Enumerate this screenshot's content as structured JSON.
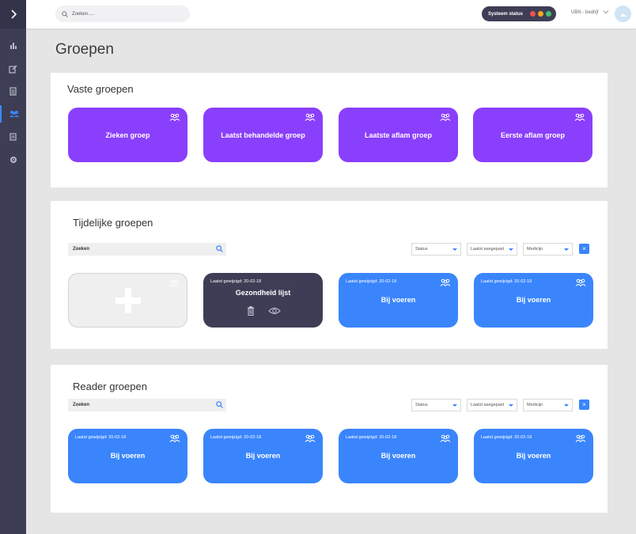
{
  "sidebar": {
    "toggle_icon": "chevron-right-icon",
    "items": [
      {
        "icon": "bar-chart-icon"
      },
      {
        "icon": "edit-icon"
      },
      {
        "icon": "document-icon"
      },
      {
        "icon": "users-icon",
        "active": true
      },
      {
        "icon": "list-icon"
      },
      {
        "icon": "gear-icon"
      }
    ]
  },
  "topbar": {
    "search_placeholder": "Zoeken.....",
    "system_status_label": "Systeem status",
    "status_colors": [
      "#f0524d",
      "#f5a623",
      "#45c06b"
    ],
    "company": "UBN - bedrijf"
  },
  "page": {
    "title": "Groepen"
  },
  "vaste": {
    "title": "Vaste groepen",
    "cards": [
      {
        "label": "Zieken groep"
      },
      {
        "label": "Laatst behandelde groep"
      },
      {
        "label": "Laatste aflam groep"
      },
      {
        "label": "Eerste aflam groep"
      }
    ]
  },
  "tijdelijke": {
    "title": "Tijdelijke groepen",
    "search_value": "Zoeken",
    "filters": [
      "Status",
      "Laatst aangepast",
      "Medicijn"
    ],
    "clear_label": "×",
    "cards": [
      {
        "type": "add"
      },
      {
        "date": "Laatst gewijzigd: 20-02-18",
        "label": "Gezondheid lijst"
      },
      {
        "date": "Laatst gewijzigd: 20-02-18",
        "label": "Bij voeren"
      },
      {
        "date": "Laatst gewijzigd: 20-02-18",
        "label": "Bij voeren"
      }
    ]
  },
  "reader": {
    "title": "Reader groepen",
    "search_value": "Zoeken",
    "filters": [
      "Status",
      "Laatst aangepast",
      "Medicijn"
    ],
    "clear_label": "×",
    "cards": [
      {
        "date": "Laatst gewijzigd: 20-02-18",
        "label": "Bij voeren"
      },
      {
        "date": "Laatst gewijzigd: 20-02-18",
        "label": "Bij voeren"
      },
      {
        "date": "Laatst gewijzigd: 20-02-18",
        "label": "Bij voeren"
      },
      {
        "date": "Laatst gewijzigd: 20-02-18",
        "label": "Bij voeren"
      }
    ]
  },
  "colors": {
    "sidebar": "#3d3e55",
    "purple": "#8a3ffc",
    "blue": "#3a85fc",
    "dark": "#3d3e55"
  }
}
